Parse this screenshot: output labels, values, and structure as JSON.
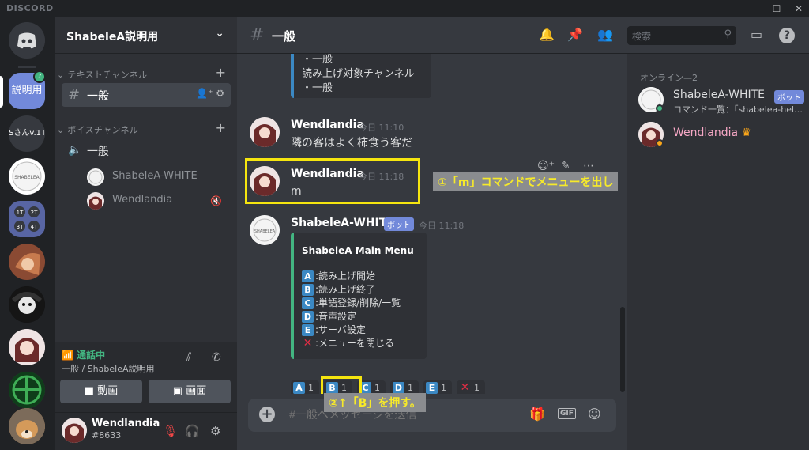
{
  "app": {
    "brand": "DISCORD",
    "minimize": "—",
    "maximize": "☐",
    "close": "✕"
  },
  "servers": [
    {
      "label": "説明用",
      "kind": "text",
      "active": true
    },
    {
      "label": "Sさんv.1T",
      "kind": "text"
    },
    {
      "label": "",
      "kind": "bot-avatar"
    },
    {
      "label": "1T 2T 3T 4T",
      "kind": "grid"
    },
    {
      "label": "",
      "kind": "avatar-hair"
    },
    {
      "label": "",
      "kind": "avatar-mask"
    },
    {
      "label": "",
      "kind": "avatar-girl"
    },
    {
      "label": "",
      "kind": "cross"
    },
    {
      "label": "",
      "kind": "dog"
    }
  ],
  "guild": {
    "name": "ShabeleA説明用"
  },
  "sidebar": {
    "text_category": "テキストチャンネル",
    "text_channel": "一般",
    "voice_category": "ボイスチャンネル",
    "voice_channel": "一般",
    "voice_users": [
      "ShabeleA-WHITE",
      "Wendlandia"
    ]
  },
  "voice_panel": {
    "status": "通話中",
    "location": "一般 / ShabeleA説明用",
    "video_label": "動画",
    "screen_label": "画面"
  },
  "user_panel": {
    "name": "Wendlandia",
    "tag": "#8633"
  },
  "header": {
    "channel": "一般",
    "search_placeholder": "検索"
  },
  "messages": {
    "embed_top": {
      "line1": "・一般",
      "line2": "読み上げ対象チャンネル",
      "line3": "・一般"
    },
    "msg1": {
      "author": "Wendlandia",
      "time": "今日 11:10",
      "text": "隣の客はよく柿食う客だ"
    },
    "msg2": {
      "author": "Wendlandia",
      "time": "今日 11:18",
      "text": "m"
    },
    "msg3": {
      "author": "ShabeleA-WHITE",
      "badge": "ボット",
      "time": "今日 11:18",
      "embed_title": "ShabeleA Main Menu",
      "items": [
        {
          "key": "A",
          "label": ":読み上げ開始"
        },
        {
          "key": "B",
          "label": ":読み上げ終了"
        },
        {
          "key": "C",
          "label": ":単語登録/削除/一覧"
        },
        {
          "key": "D",
          "label": ":音声設定"
        },
        {
          "key": "E",
          "label": ":サーバ設定"
        },
        {
          "key": "X",
          "label": ":メニューを閉じる"
        }
      ],
      "reactions": [
        {
          "key": "A",
          "count": "1"
        },
        {
          "key": "B",
          "count": "1"
        },
        {
          "key": "C",
          "count": "1"
        },
        {
          "key": "D",
          "count": "1"
        },
        {
          "key": "E",
          "count": "1"
        },
        {
          "key": "X",
          "count": "1"
        }
      ]
    }
  },
  "annotations": {
    "note1": "①「m」コマンドでメニューを出し",
    "note2": "②↑「B」を押す。"
  },
  "composer": {
    "placeholder": "#一般へメッセージを送信",
    "gif": "GIF"
  },
  "members": {
    "category": "オンライン—2",
    "list": [
      {
        "name": "ShabeleA-WHITE",
        "badge": "ボット",
        "sub": "コマンド一覧：「shabelea-help」",
        "color": "#dcddde"
      },
      {
        "name": "Wendlandia",
        "color": "#f7a8c6"
      }
    ]
  },
  "colors": {
    "accent": "#7289da",
    "online": "#43b581",
    "highlight": "#f5e50f"
  }
}
